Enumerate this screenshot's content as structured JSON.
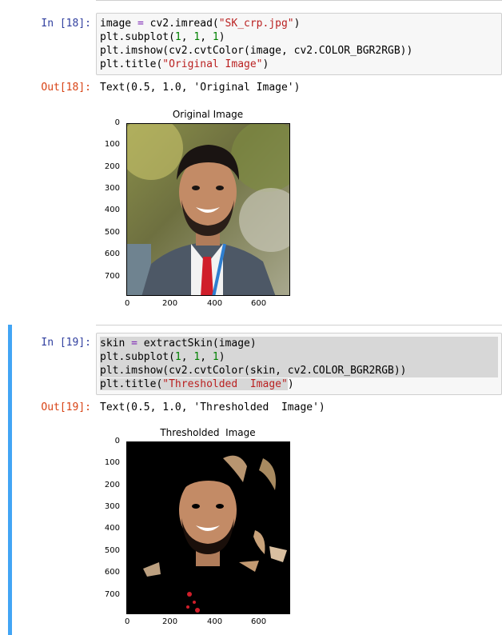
{
  "cell18": {
    "in_prompt": "In [18]:",
    "out_prompt": "Out[18]:",
    "code": {
      "l1_a": "image ",
      "l1_op": "=",
      "l1_b": " cv2.imread(",
      "l1_str": "\"SK_crp.jpg\"",
      "l1_c": ")",
      "l2_a": "plt.subplot(",
      "l2_n1": "1",
      "l2_s1": ", ",
      "l2_n2": "1",
      "l2_s2": ", ",
      "l2_n3": "1",
      "l2_c": ")",
      "l3": "plt.imshow(cv2.cvtColor(image, cv2.COLOR_BGR2RGB))",
      "l4_a": "plt.title(",
      "l4_str": "\"Original Image\"",
      "l4_c": ")"
    },
    "output_text": "Text(0.5, 1.0, 'Original Image')",
    "plot_title": "Original Image"
  },
  "cell19": {
    "in_prompt": "In [19]:",
    "out_prompt": "Out[19]:",
    "code": {
      "l1_a": "skin ",
      "l1_op": "=",
      "l1_b": " extractSkin(image)",
      "l2_a": "plt.subplot(",
      "l2_n1": "1",
      "l2_s1": ", ",
      "l2_n2": "1",
      "l2_s2": ", ",
      "l2_n3": "1",
      "l2_c": ")",
      "l3": "plt.imshow(cv2.cvtColor(skin, cv2.COLOR_BGR2RGB))",
      "l4_a": "plt.title(",
      "l4_str": "\"Thresholded  Image\"",
      "l4_c": ")"
    },
    "output_text": "Text(0.5, 1.0, 'Thresholded  Image')",
    "plot_title": "Thresholded  Image"
  },
  "axes": {
    "y_ticks": [
      "0",
      "100",
      "200",
      "300",
      "400",
      "500",
      "600",
      "700"
    ],
    "x_ticks": [
      "0",
      "200",
      "400",
      "600"
    ]
  },
  "colors": {
    "in_prompt": "#303f9f",
    "out_prompt": "#d84315",
    "selected_bar": "#42a5f5",
    "string": "#ba2121",
    "number": "#008000",
    "operator": "#7c25b5"
  }
}
